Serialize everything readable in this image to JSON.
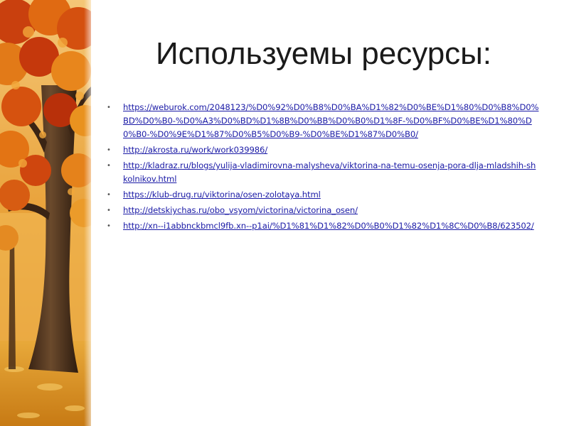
{
  "slide": {
    "title": "Используемы ресурсы:",
    "bullet_glyph": "•",
    "link_color": "#1a1aa6",
    "links": [
      {
        "text": "https://weburok.com/2048123/%D0%92%D0%B8%D0%BA%D1%82%D0%BE%D1%80%D0%B8%D0%BD%D0%B0-%D0%A3%D0%BD%D1%8B%D0%BB%D0%B0%D1%8F-%D0%BF%D0%BE%D1%80%D0%B0-%D0%9E%D1%87%D0%B5%D0%B9-%D0%BE%D1%87%D0%B0/"
      },
      {
        "text": "http://akrosta.ru/work/work039986/"
      },
      {
        "text": "http://kladraz.ru/blogs/yulija-vladimirovna-malysheva/viktorina-na-temu-osenja-pora-dlja-mladshih-shkolnikov.html"
      },
      {
        "text": "https://klub-drug.ru/viktorina/osen-zolotaya.html"
      },
      {
        "text": "http://detskiychas.ru/obo_vsyom/victorina/victorina_osen/"
      },
      {
        "text": "http://xn--i1abbnckbmcl9fb.xn--p1ai/%D1%81%D1%82%D0%B0%D1%82%D1%8C%D0%B8/623502/"
      }
    ]
  }
}
